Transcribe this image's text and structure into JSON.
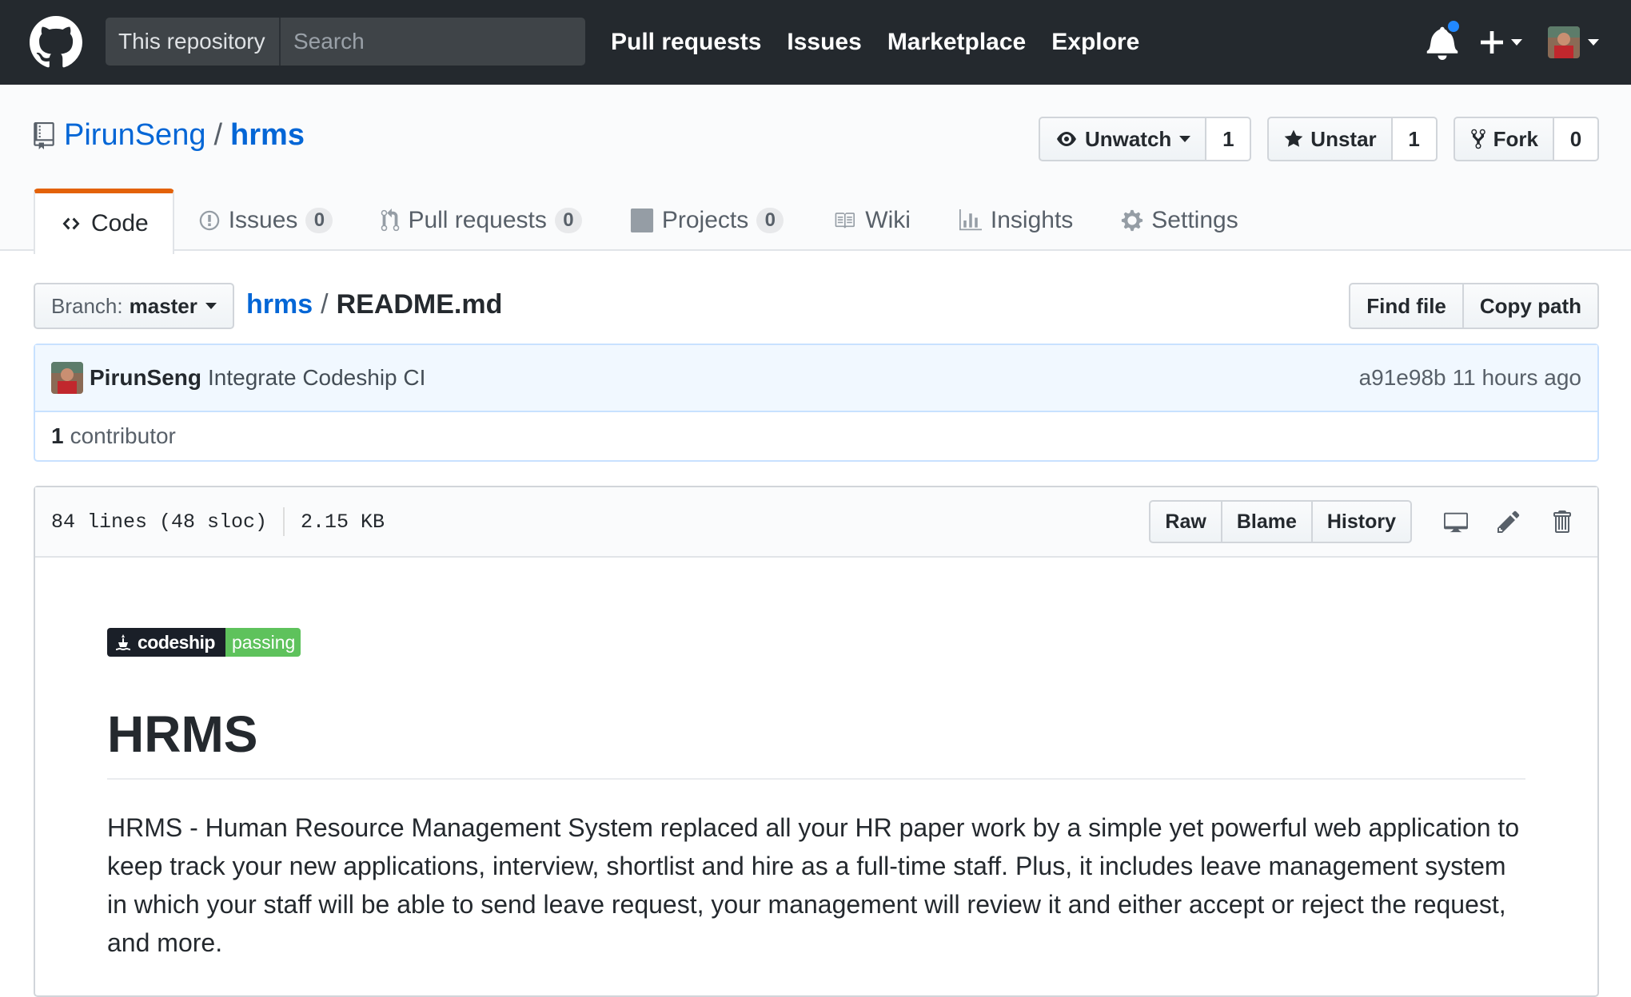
{
  "header": {
    "scope_label": "This repository",
    "search_placeholder": "Search",
    "nav": [
      "Pull requests",
      "Issues",
      "Marketplace",
      "Explore"
    ],
    "notification_color": "#2188ff"
  },
  "repo": {
    "owner": "PirunSeng",
    "separator": "/",
    "name": "hrms",
    "watch_label": "Unwatch",
    "watch_count": "1",
    "star_label": "Unstar",
    "star_count": "1",
    "fork_label": "Fork",
    "fork_count": "0"
  },
  "tabs": {
    "code": "Code",
    "issues": "Issues",
    "issues_count": "0",
    "pulls": "Pull requests",
    "pulls_count": "0",
    "projects": "Projects",
    "projects_count": "0",
    "wiki": "Wiki",
    "insights": "Insights",
    "settings": "Settings",
    "accent": "#e36209"
  },
  "file_nav": {
    "branch_label": "Branch:",
    "branch": "master",
    "crumb_root": "hrms",
    "crumb_sep": "/",
    "crumb_file": "README.md",
    "find_file": "Find file",
    "copy_path": "Copy path"
  },
  "commit": {
    "author": "PirunSeng",
    "message": "Integrate Codeship CI",
    "sha": "a91e98b",
    "time": "11 hours ago",
    "contributors_count": "1",
    "contributors_label": "contributor"
  },
  "file": {
    "lines": "84 lines (48 sloc)",
    "size": "2.15 KB",
    "raw": "Raw",
    "blame": "Blame",
    "history": "History"
  },
  "readme": {
    "badge_left": "codeship",
    "badge_right": "passing",
    "heading": "HRMS",
    "paragraph": "HRMS - Human Resource Management System replaced all your HR paper work by a simple yet powerful web application to keep track your new applications, interview, shortlist and hire as a full-time staff. Plus, it includes leave management system in which your staff will be able to send leave request, your management will review it and either accept or reject the request, and more."
  }
}
